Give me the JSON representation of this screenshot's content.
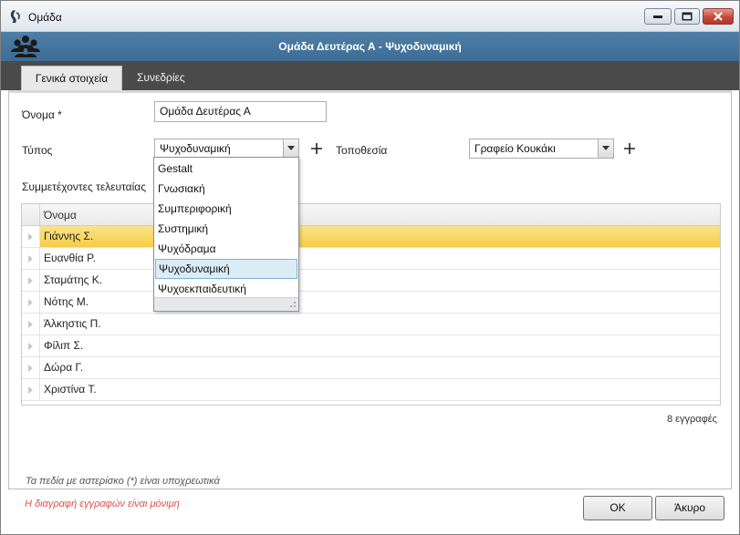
{
  "window": {
    "title": "Ομάδα"
  },
  "header": {
    "title": "Ομάδα Δευτέρας Α - Ψυχοδυναμική"
  },
  "tabs": [
    {
      "label": "Γενικά στοιχεία",
      "active": true
    },
    {
      "label": "Συνεδρίες",
      "active": false
    }
  ],
  "form": {
    "name_label": "Όνομα *",
    "name_value": "Ομάδα Δευτέρας Α",
    "type_label": "Τύπος",
    "type_value": "Ψυχοδυναμική",
    "location_label": "Τοποθεσία",
    "location_value": "Γραφείο Κουκάκι",
    "participants_label": "Συμμετέχοντες τελευταίας"
  },
  "dropdown": {
    "options": [
      "Gestalt",
      "Γνωσιακή",
      "Συμπεριφορική",
      "Συστημική",
      "Ψυχόδραμα",
      "Ψυχοδυναμική",
      "Ψυχοεκπαιδευτική"
    ],
    "selected_index": 5
  },
  "grid": {
    "column": "Όνομα",
    "rows": [
      "Γιάννης Σ.",
      "Ευανθία Ρ.",
      "Σταμάτης Κ.",
      "Νότης Μ.",
      "Άλκηστις Π.",
      "Φίλιπ Σ.",
      "Δώρα Γ.",
      "Χριστίνα Τ."
    ],
    "selected_index": 0
  },
  "record_count": "8 εγγραφές",
  "required_note": "Τα πεδία με αστερίσκο (*) είναι υποχρεωτικά",
  "delete_note": "Η διαγραφή εγγραφών είναι μόνιμη",
  "buttons": {
    "ok": "OK",
    "cancel": "Άκυρο"
  },
  "colors": {
    "header": "#4472a0",
    "selected_row": "#f6cd46",
    "warning": "#d9534f"
  },
  "icons": {
    "app": "app-logo-icon",
    "group": "group-people-icon",
    "add": "plus-icon",
    "dropdown": "chevron-down-icon"
  }
}
